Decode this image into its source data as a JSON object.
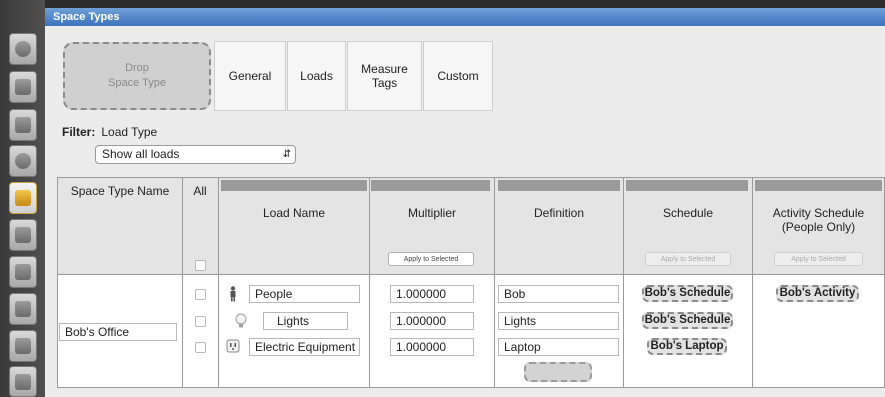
{
  "window": {
    "title": "Space Types"
  },
  "sidebar": {
    "icons": [
      "globe-icon",
      "calendar-icon",
      "building-blocks-icon",
      "plug-icon",
      "space-type-icon",
      "construction-icon",
      "buildings-icon",
      "thermal-zone-icon",
      "geometry-icon",
      "transfer-icon"
    ],
    "active_index": 4
  },
  "toolbar": {
    "drop_label": "Drop\nSpace Type",
    "tabs": [
      "General",
      "Loads",
      "Measure\nTags",
      "Custom"
    ]
  },
  "filter": {
    "label": "Filter:",
    "type": "Load Type",
    "selected": "Show all loads"
  },
  "table": {
    "headers": {
      "space_type_name": "Space Type Name",
      "all": "All",
      "load_name": "Load Name",
      "multiplier": "Multiplier",
      "definition": "Definition",
      "schedule": "Schedule",
      "activity_schedule": "Activity Schedule\n(People Only)"
    },
    "apply_to_selected": "Apply to Selected",
    "row": {
      "space_type_name": "Bob's Office",
      "loads": [
        {
          "icon": "person-icon",
          "name": "People",
          "multiplier": "1.000000",
          "definition": "Bob",
          "schedule": "Bob's Schedule",
          "activity_schedule": "Bob's Activity"
        },
        {
          "icon": "lightbulb-icon",
          "name": "Lights",
          "multiplier": "1.000000",
          "definition": "Lights",
          "schedule": "Bob's Schedule",
          "activity_schedule": ""
        },
        {
          "icon": "outlet-icon",
          "name": "Electric Equipment",
          "multiplier": "1.000000",
          "definition": "Laptop",
          "schedule": "Bob's Laptop",
          "activity_schedule": ""
        }
      ]
    }
  }
}
